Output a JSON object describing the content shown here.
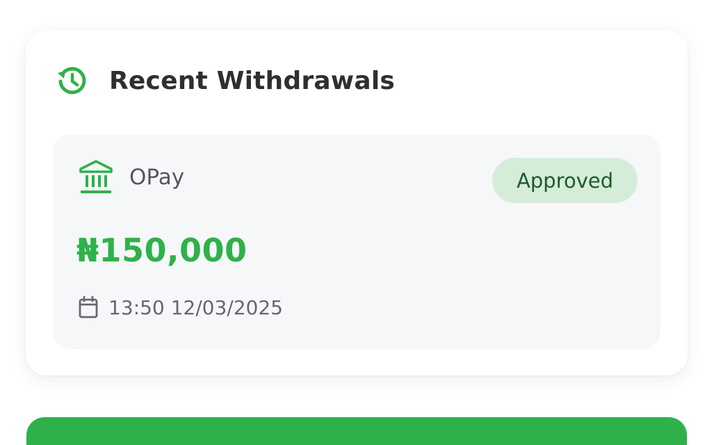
{
  "colors": {
    "accent_green": "#2fb14a",
    "badge_bg": "#d5ecd9",
    "badge_text": "#1e5a2b",
    "title_text": "#2f2f33",
    "item_bg": "#f6f7f9"
  },
  "section": {
    "title": "Recent Withdrawals",
    "icon": "history-icon"
  },
  "withdrawals": [
    {
      "bank": "OPay",
      "bank_icon": "bank-icon",
      "status": "Approved",
      "amount": "₦150,000",
      "date_icon": "calendar-icon",
      "datetime": "13:50 12/03/2025"
    }
  ]
}
